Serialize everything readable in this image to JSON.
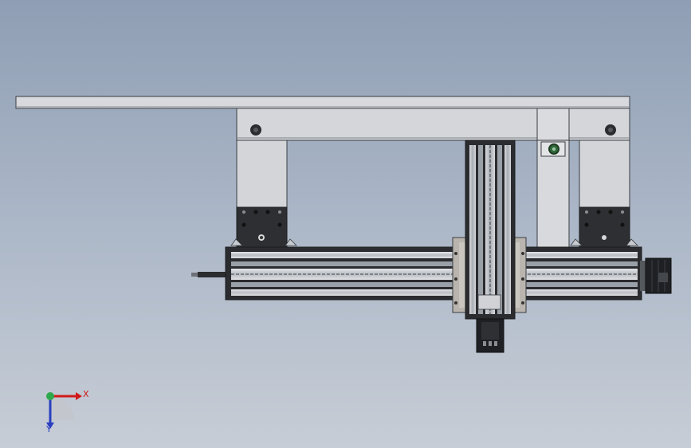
{
  "viewport": {
    "description_free": true
  },
  "triad": {
    "x_label": "X",
    "y_label": "Y",
    "x_color": "#d11a1a",
    "y_color": "#2a3fbf",
    "z_color": "#2ea84a"
  },
  "colors": {
    "part_light": "#d3d5d8",
    "part_mid": "#b8bcc2",
    "part_dark": "#2f3033",
    "edge": "#3a3d42",
    "motor": "#1e1f22"
  }
}
